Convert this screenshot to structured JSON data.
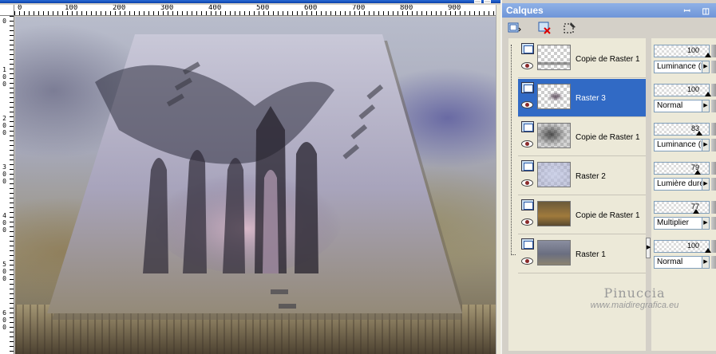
{
  "palette": {
    "title": "Calques",
    "title_buttons": "ꟷ ◫",
    "tools": [
      {
        "icon": "new-raster-layer-icon"
      },
      {
        "icon": "delete-layer-icon"
      },
      {
        "icon": "edit-selection-icon"
      }
    ]
  },
  "rulers": {
    "horizontal": [
      "0",
      "100",
      "200",
      "300",
      "400",
      "500",
      "600",
      "700",
      "800",
      "900"
    ],
    "vertical": [
      "0",
      "100",
      "200",
      "300",
      "400",
      "500",
      "600"
    ]
  },
  "layers": [
    {
      "name": "Copie de Raster 1",
      "selected": false,
      "opacity": 100,
      "blend_mode": "Luminance (H)"
    },
    {
      "name": "Raster 3",
      "selected": true,
      "opacity": 100,
      "blend_mode": "Normal"
    },
    {
      "name": "Copie de Raster 1",
      "selected": false,
      "opacity": 83,
      "blend_mode": "Luminance (H)"
    },
    {
      "name": "Raster 2",
      "selected": false,
      "opacity": 79,
      "blend_mode": "Lumière dure"
    },
    {
      "name": "Copie de Raster 1",
      "selected": false,
      "opacity": 77,
      "blend_mode": "Multiplier"
    },
    {
      "name": "Raster 1",
      "selected": false,
      "opacity": 100,
      "blend_mode": "Normal"
    }
  ],
  "watermark": {
    "name": "Pinuccia",
    "url": "www.maidiregrafica.eu"
  },
  "colors": {
    "selection": "#316ac5",
    "panel": "#ece9d8",
    "titlebar": "#7a9ddc"
  }
}
